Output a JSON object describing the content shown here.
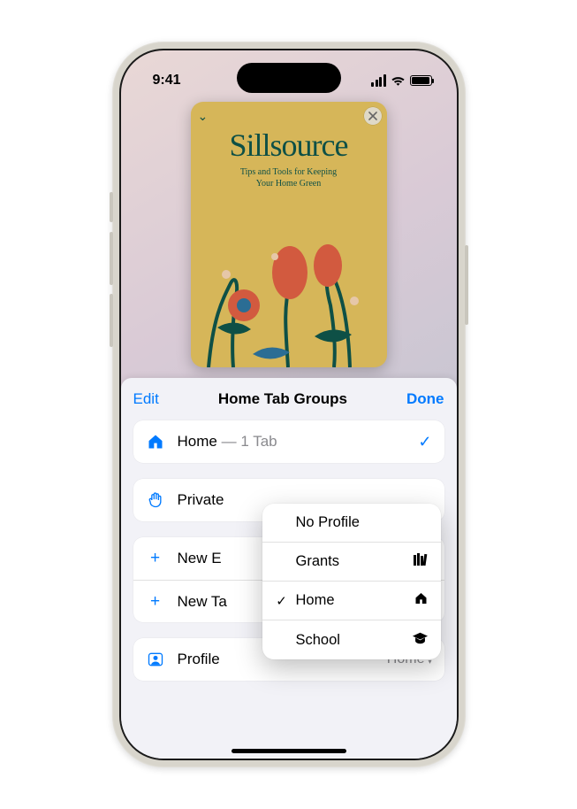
{
  "status": {
    "time": "9:41"
  },
  "tab_card": {
    "title": "Sillsource",
    "subtitle_line1": "Tips and Tools for Keeping",
    "subtitle_line2": "Your Home Green"
  },
  "sheet": {
    "edit": "Edit",
    "title": "Home Tab Groups",
    "done": "Done",
    "home_row": {
      "label": "Home",
      "suffix": "— 1 Tab"
    },
    "private_row": {
      "label": "Private"
    },
    "new_empty": "New Empty Tab Group",
    "new_from": "New Tab Group from 1 Tab",
    "new_empty_clipped": "New E",
    "new_from_clipped": "New Ta",
    "profile": {
      "label": "Profile",
      "value": "Home"
    }
  },
  "popover": {
    "items": [
      {
        "label": "No Profile",
        "selected": false,
        "icon": null
      },
      {
        "label": "Grants",
        "selected": false,
        "icon": "books"
      },
      {
        "label": "Home",
        "selected": true,
        "icon": "house"
      },
      {
        "label": "School",
        "selected": false,
        "icon": "grad"
      }
    ]
  }
}
